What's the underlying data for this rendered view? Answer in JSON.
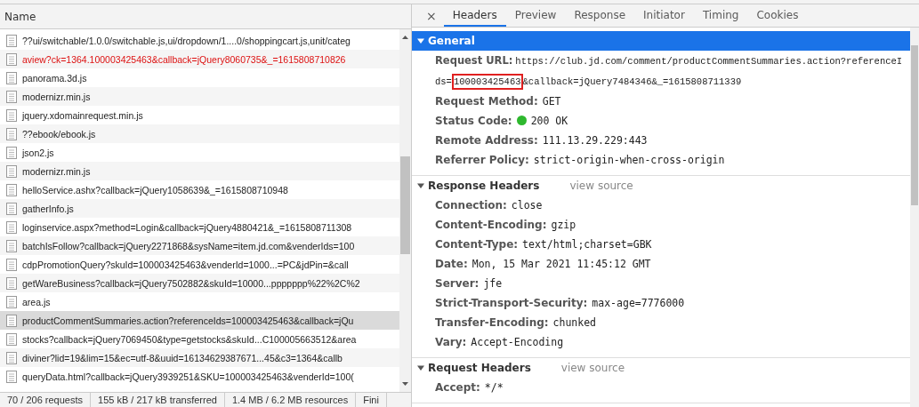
{
  "request_list": {
    "column": "Name",
    "rows": [
      {
        "name": "??ui/switchable/1.0.0/switchable.js,ui/dropdown/1....0/shoppingcart.js,unit/categ",
        "selected": false,
        "failed": false
      },
      {
        "name": "aview?ck=1364.100003425463&callback=jQuery8060735&_=1615808710826",
        "selected": false,
        "failed": true
      },
      {
        "name": "panorama.3d.js",
        "selected": false,
        "failed": false
      },
      {
        "name": "modernizr.min.js",
        "selected": false,
        "failed": false
      },
      {
        "name": "jquery.xdomainrequest.min.js",
        "selected": false,
        "failed": false
      },
      {
        "name": "??ebook/ebook.js",
        "selected": false,
        "failed": false
      },
      {
        "name": "json2.js",
        "selected": false,
        "failed": false
      },
      {
        "name": "modernizr.min.js",
        "selected": false,
        "failed": false
      },
      {
        "name": "helloService.ashx?callback=jQuery1058639&_=1615808710948",
        "selected": false,
        "failed": false
      },
      {
        "name": "gatherInfo.js",
        "selected": false,
        "failed": false
      },
      {
        "name": "loginservice.aspx?method=Login&callback=jQuery4880421&_=1615808711308",
        "selected": false,
        "failed": false
      },
      {
        "name": "batchIsFollow?callback=jQuery2271868&sysName=item.jd.com&venderIds=100",
        "selected": false,
        "failed": false
      },
      {
        "name": "cdpPromotionQuery?skuId=100003425463&venderId=1000...=PC&jdPin=&call",
        "selected": false,
        "failed": false
      },
      {
        "name": "getWareBusiness?callback=jQuery7502882&skuId=10000...ppppppp%22%2C%2",
        "selected": false,
        "failed": false
      },
      {
        "name": "area.js",
        "selected": false,
        "failed": false
      },
      {
        "name": "productCommentSummaries.action?referenceIds=100003425463&callback=jQu",
        "selected": true,
        "failed": false
      },
      {
        "name": "stocks?callback=jQuery7069450&type=getstocks&skuId...C100005663512&area",
        "selected": false,
        "failed": false
      },
      {
        "name": "diviner?lid=19&lim=15&ec=utf-8&uuid=16134629387671...45&c3=1364&callb",
        "selected": false,
        "failed": false
      },
      {
        "name": "queryData.html?callback=jQuery3939251&SKU=100003425463&venderId=100(",
        "selected": false,
        "failed": false
      }
    ]
  },
  "status_bar": [
    "70 / 206 requests",
    "155 kB / 217 kB transferred",
    "1.4 MB / 6.2 MB resources",
    "Fini"
  ],
  "tabs": [
    {
      "label": "Headers",
      "selected": true
    },
    {
      "label": "Preview",
      "selected": false
    },
    {
      "label": "Response",
      "selected": false
    },
    {
      "label": "Initiator",
      "selected": false
    },
    {
      "label": "Timing",
      "selected": false
    },
    {
      "label": "Cookies",
      "selected": false
    }
  ],
  "close_button": "×",
  "sections": [
    {
      "title": "General",
      "expanded": true,
      "selected": true,
      "items": [
        {
          "key": "Request URL:",
          "kind": "url",
          "parts": [
            {
              "text": "https://club.jd.com/comment/productCommentSummaries.action?referenceI",
              "highlighted": false,
              "new_line": false
            },
            {
              "text": "ds=",
              "highlighted": false,
              "new_line": true
            },
            {
              "text": "100003425463",
              "highlighted": true,
              "new_line": false
            },
            {
              "text": "&callback=jQuery7484346&_=1615808711339",
              "highlighted": false,
              "new_line": false
            }
          ]
        },
        {
          "key": "Request Method:",
          "kind": "plain",
          "value": "GET"
        },
        {
          "key": "Status Code:",
          "kind": "status",
          "value": "200 OK",
          "color": "#2eb82e"
        },
        {
          "key": "Remote Address:",
          "kind": "plain",
          "value": "111.13.29.229:443"
        },
        {
          "key": "Referrer Policy:",
          "kind": "plain",
          "value": "strict-origin-when-cross-origin"
        }
      ]
    },
    {
      "title": "Response Headers",
      "link": "view source",
      "expanded": true,
      "selected": false,
      "items": [
        {
          "key": "Connection:",
          "kind": "plain",
          "value": "close"
        },
        {
          "key": "Content-Encoding:",
          "kind": "plain",
          "value": "gzip"
        },
        {
          "key": "Content-Type:",
          "kind": "plain",
          "value": "text/html;charset=GBK"
        },
        {
          "key": "Date:",
          "kind": "plain",
          "value": "Mon, 15 Mar 2021 11:45:12 GMT"
        },
        {
          "key": "Server:",
          "kind": "plain",
          "value": "jfe"
        },
        {
          "key": "Strict-Transport-Security:",
          "kind": "plain",
          "value": "max-age=7776000"
        },
        {
          "key": "Transfer-Encoding:",
          "kind": "plain",
          "value": "chunked"
        },
        {
          "key": "Vary:",
          "kind": "plain",
          "value": "Accept-Encoding"
        }
      ]
    },
    {
      "title": "Request Headers",
      "link": "view source",
      "expanded": true,
      "selected": false,
      "items": [
        {
          "key": "Accept:",
          "kind": "plain",
          "value": "*/*"
        }
      ]
    }
  ]
}
